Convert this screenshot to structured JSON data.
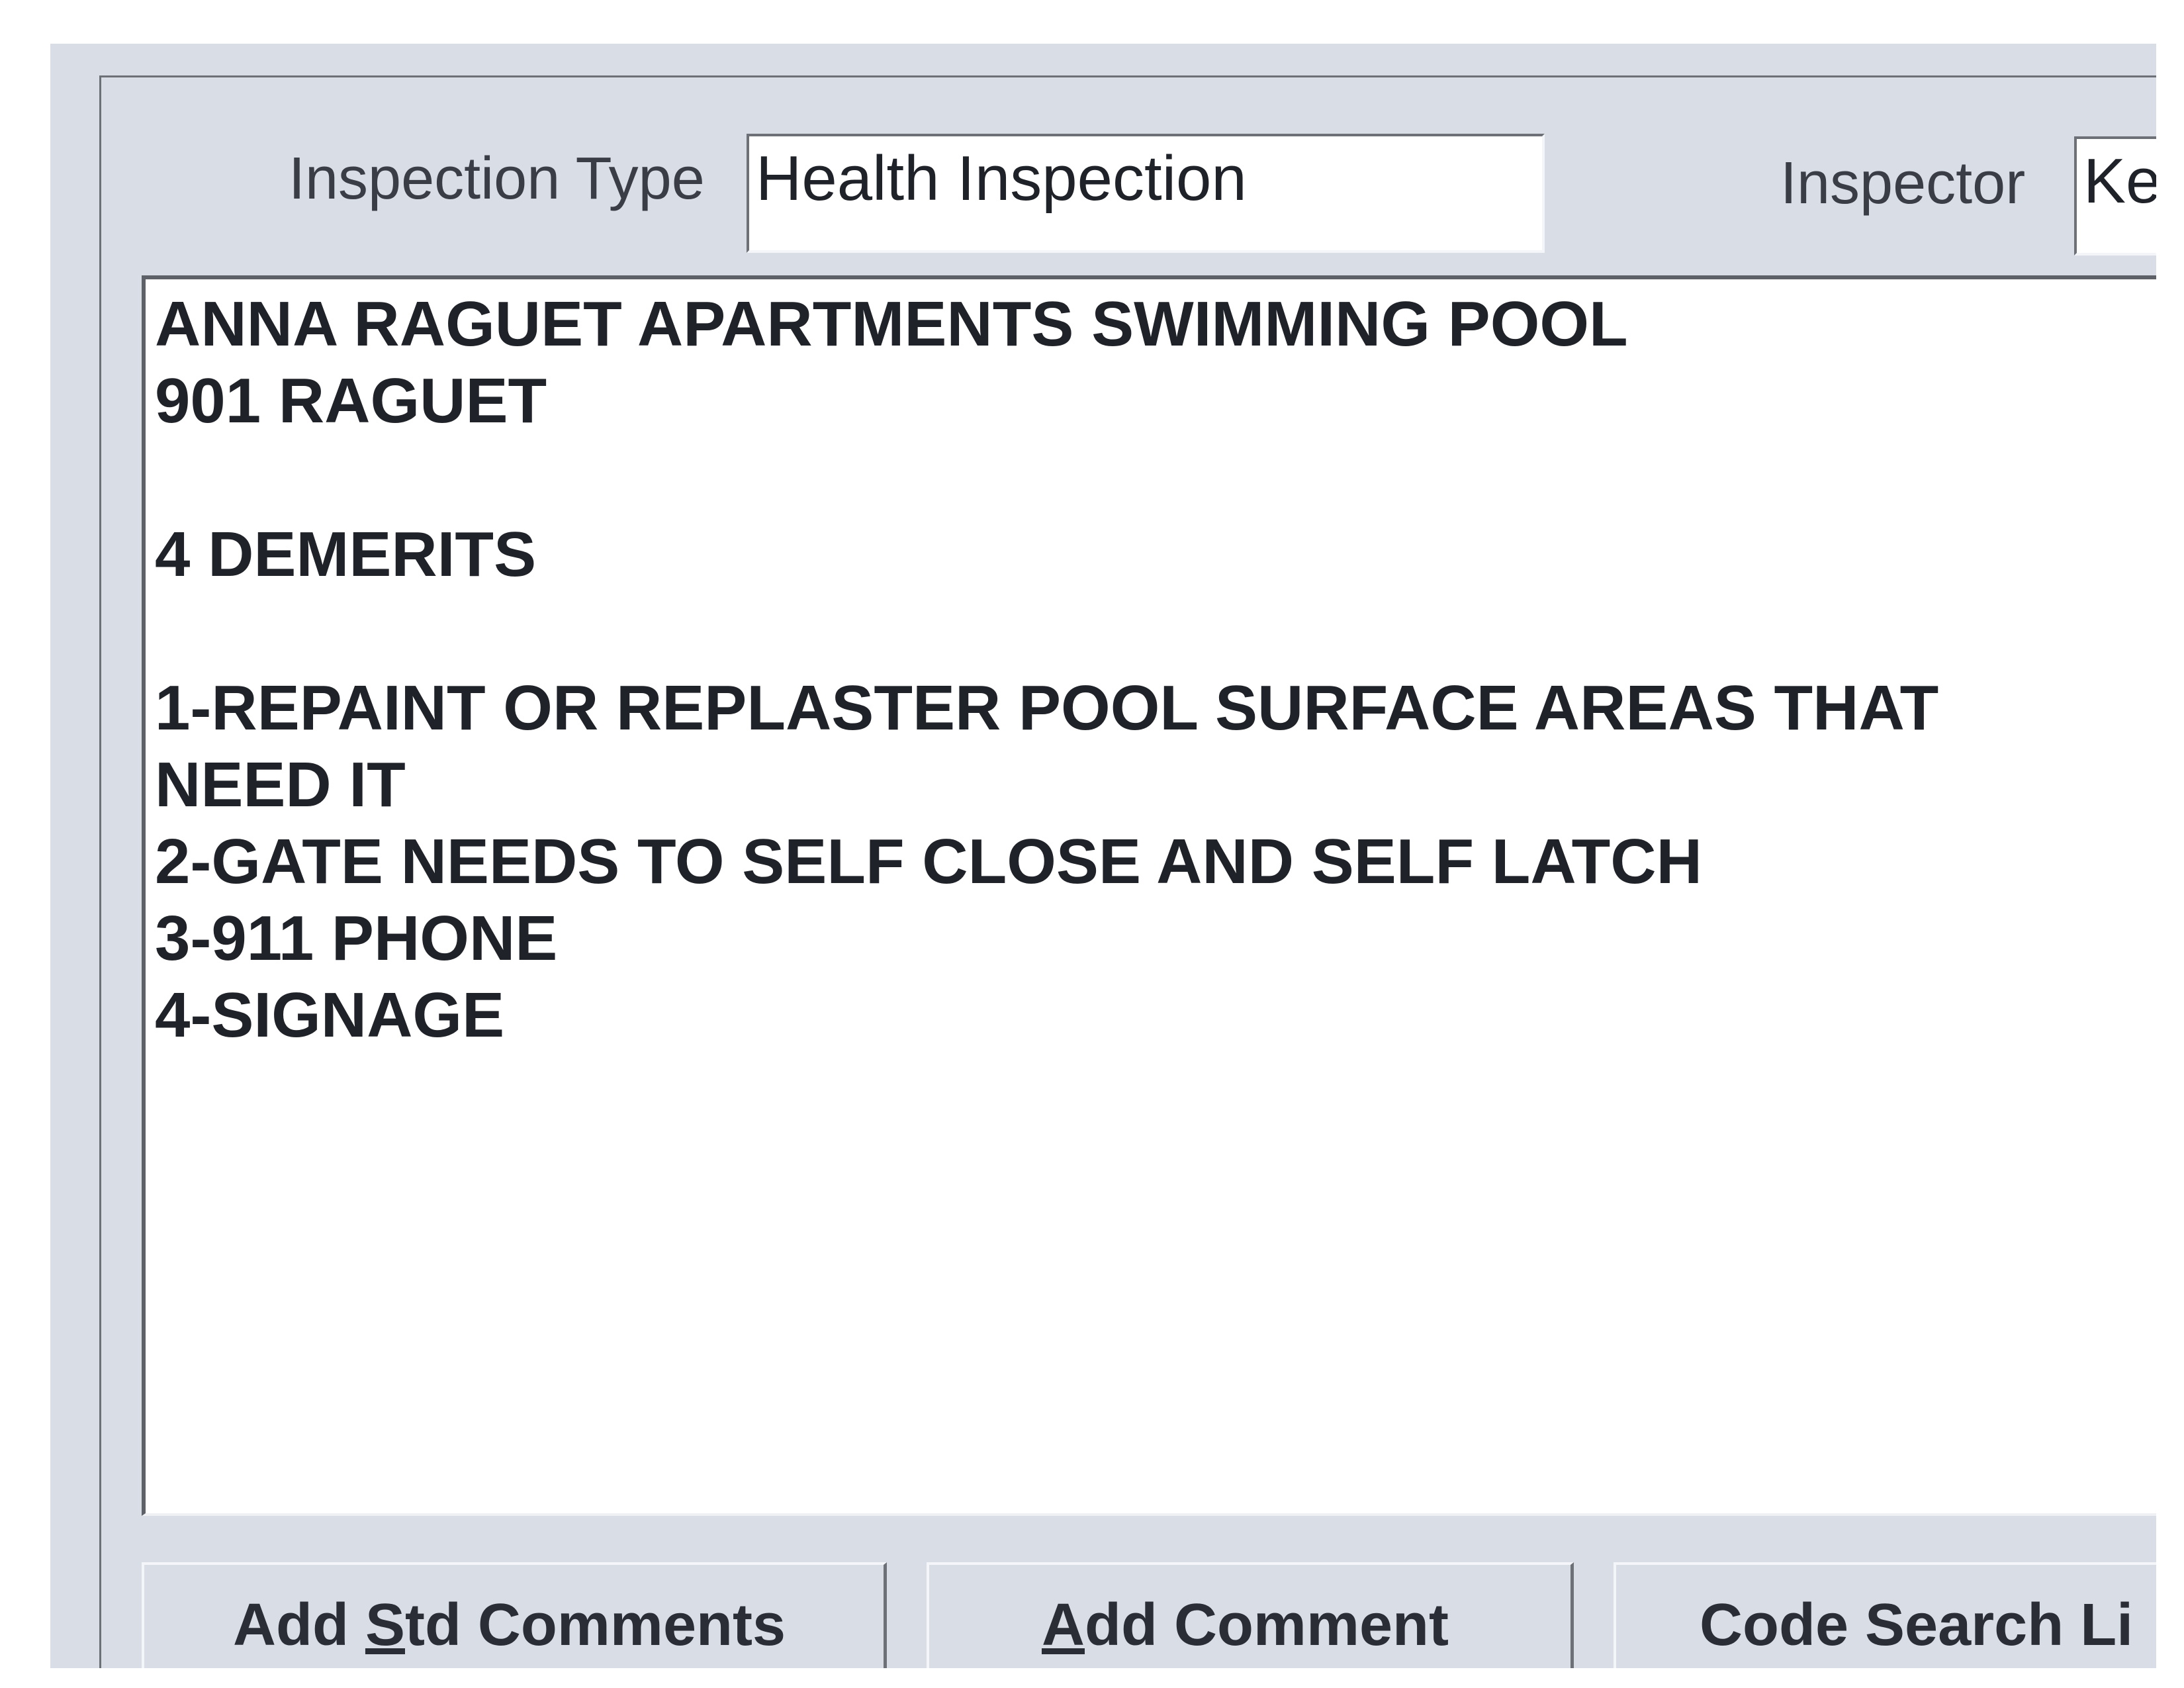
{
  "inspection_type": {
    "label": "Inspection Type",
    "value": "Health Inspection"
  },
  "inspector": {
    "label": "Inspector",
    "value": "Ke"
  },
  "notes": {
    "lines": [
      "ANNA RAGUET APARTMENTS SWIMMING POOL",
      "901 RAGUET",
      "",
      "4 DEMERITS",
      "",
      "1-REPAINT OR REPLASTER POOL SURFACE AREAS THAT",
      "NEED IT",
      "2-GATE NEEDS TO SELF CLOSE AND SELF LATCH",
      "3-911 PHONE",
      "4-SIGNAGE"
    ]
  },
  "buttons": {
    "add_std_comments": {
      "before": "Add ",
      "mnemonic": "S",
      "after": "td Comments"
    },
    "add_comment": {
      "before": "",
      "mnemonic": "A",
      "after": "dd Comment"
    },
    "code_search": {
      "label": "Code Search Li"
    }
  },
  "colors": {
    "window_background": "#d9dde5",
    "field_background": "#ffffff",
    "text": "#1f2228"
  }
}
